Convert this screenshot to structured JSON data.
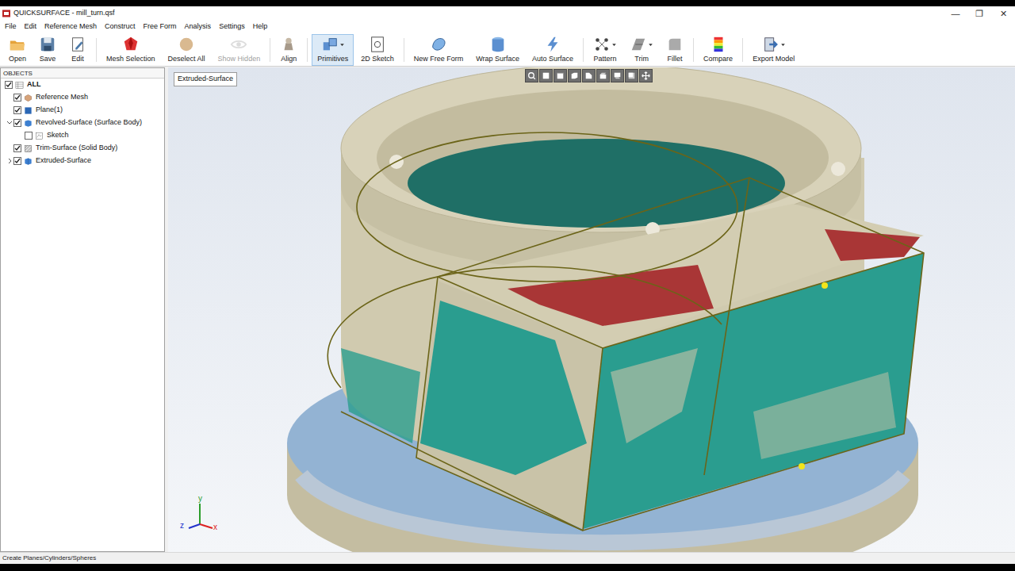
{
  "window": {
    "title": "QUICKSURFACE - mill_turn.qsf",
    "controls": [
      "—",
      "❐",
      "✕"
    ]
  },
  "menu": [
    "File",
    "Edit",
    "Reference Mesh",
    "Construct",
    "Free Form",
    "Analysis",
    "Settings",
    "Help"
  ],
  "toolbar": [
    {
      "label": "Open",
      "disabled": false,
      "selected": false,
      "dropdown": false
    },
    {
      "label": "Save",
      "disabled": false,
      "selected": false,
      "dropdown": false
    },
    {
      "label": "Edit",
      "disabled": false,
      "selected": false,
      "dropdown": false
    },
    {
      "label": "Mesh Selection",
      "disabled": false,
      "selected": false,
      "dropdown": false
    },
    {
      "label": "Deselect All",
      "disabled": false,
      "selected": false,
      "dropdown": false
    },
    {
      "label": "Show Hidden",
      "disabled": true,
      "selected": false,
      "dropdown": false
    },
    {
      "label": "Align",
      "disabled": false,
      "selected": false,
      "dropdown": false
    },
    {
      "label": "Primitives",
      "disabled": false,
      "selected": true,
      "dropdown": true
    },
    {
      "label": "2D Sketch",
      "disabled": false,
      "selected": false,
      "dropdown": false
    },
    {
      "label": "New Free Form",
      "disabled": false,
      "selected": false,
      "dropdown": false
    },
    {
      "label": "Wrap Surface",
      "disabled": false,
      "selected": false,
      "dropdown": false
    },
    {
      "label": "Auto Surface",
      "disabled": false,
      "selected": false,
      "dropdown": false
    },
    {
      "label": "Pattern",
      "disabled": false,
      "selected": false,
      "dropdown": true
    },
    {
      "label": "Trim",
      "disabled": false,
      "selected": false,
      "dropdown": true
    },
    {
      "label": "Fillet",
      "disabled": false,
      "selected": false,
      "dropdown": false
    },
    {
      "label": "Compare",
      "disabled": false,
      "selected": false,
      "dropdown": false
    },
    {
      "label": "Export Model",
      "disabled": false,
      "selected": false,
      "dropdown": true
    }
  ],
  "objects": {
    "header": "OBJECTS",
    "items": [
      {
        "label": "ALL",
        "depth": 0,
        "checked": true
      },
      {
        "label": "Reference Mesh",
        "depth": 1,
        "checked": true
      },
      {
        "label": "Plane(1)",
        "depth": 1,
        "checked": true
      },
      {
        "label": "Revolved-Surface (Surface Body)",
        "depth": 1,
        "checked": true,
        "expanded": true
      },
      {
        "label": "Sketch",
        "depth": 2,
        "checked": false
      },
      {
        "label": "Trim-Surface (Solid Body)",
        "depth": 1,
        "checked": true
      },
      {
        "label": "Extruded-Surface",
        "depth": 1,
        "checked": true,
        "expanded": false
      }
    ]
  },
  "viewport": {
    "label": "Extruded-Surface",
    "axes": [
      "y",
      "z",
      "x"
    ]
  },
  "status_bar": "Create Planes/Cylinders/Spheres"
}
